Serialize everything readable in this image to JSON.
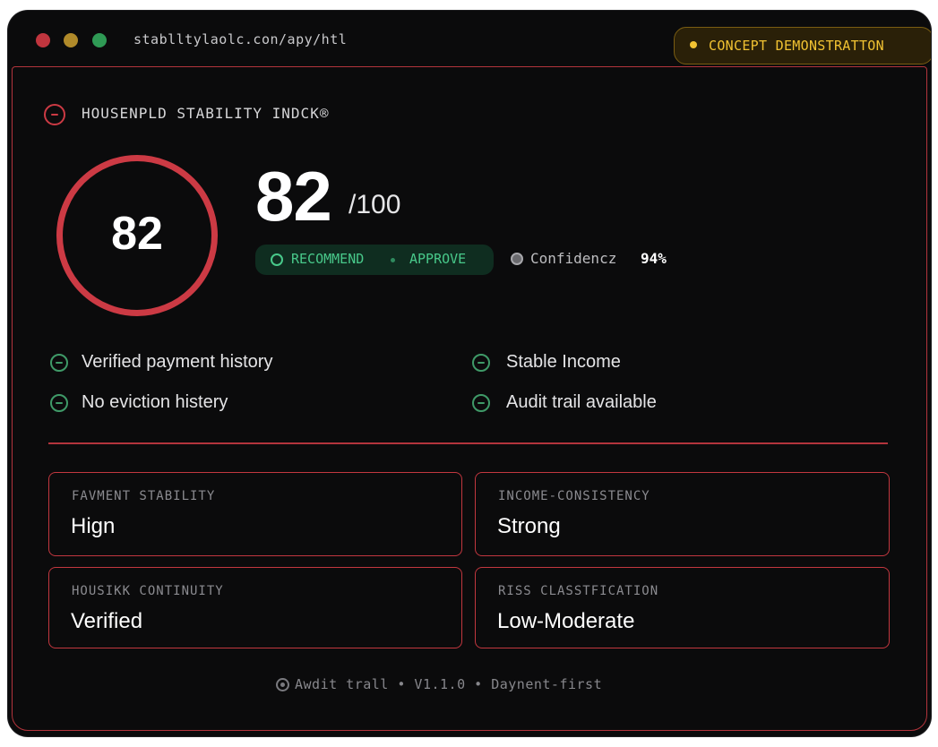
{
  "window": {
    "url": "stablltylaolc.con/apy/htl",
    "badge_label": "CONCEPT DEMONSTRATTON"
  },
  "header": {
    "title": "HOUSENPLD STABILITY INDCK®"
  },
  "score": {
    "value": "82",
    "ring_value": "82",
    "max": "/100",
    "recommendation": "RECOMMEND",
    "decision": "APPROVE",
    "confidence_label": "Confidencz",
    "confidence_value": "94%"
  },
  "features": [
    {
      "label": "Verified payment history"
    },
    {
      "label": "Stable Income"
    },
    {
      "label": "No eviction histery"
    },
    {
      "label": "Audit trail available"
    }
  ],
  "cards": [
    {
      "label": "FAVMENT STABILITY",
      "value": "Hign"
    },
    {
      "label": "INCOME-CONSISTENCY",
      "value": "Strong"
    },
    {
      "label": "HOUSIKK CONTINUITY",
      "value": "Verified"
    },
    {
      "label": "RISS CLASSTFICATION",
      "value": "Low-Moderate"
    }
  ],
  "footer": {
    "text": "Awdit trall • V1.1.0 • Daynent-first"
  },
  "colors": {
    "accent_red": "#cc3a44",
    "accent_green": "#48c98a",
    "badge_yellow": "#f1c232",
    "background": "#0b0b0c"
  },
  "icons": {
    "header": "minus-circle-icon",
    "feature": "minus-circle-icon",
    "confidence": "shield-icon",
    "footer": "target-icon"
  }
}
